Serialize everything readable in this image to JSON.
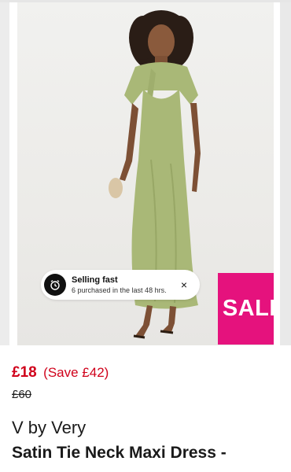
{
  "badge": {
    "selling_fast_title": "Selling fast",
    "selling_fast_detail": "6 purchased in the last 48 hrs.",
    "close_symbol": "×",
    "sale_label": "SALE",
    "icon": "alarm-clock-icon"
  },
  "product": {
    "price_now": "£18",
    "price_save": "(Save £42)",
    "price_was": "£60",
    "brand": "V by Very",
    "title": "Satin Tie Neck Maxi Dress -"
  },
  "colors": {
    "sale_pink": "#e5127d",
    "price_red": "#d0021b",
    "dress_green": "#a9b877"
  }
}
